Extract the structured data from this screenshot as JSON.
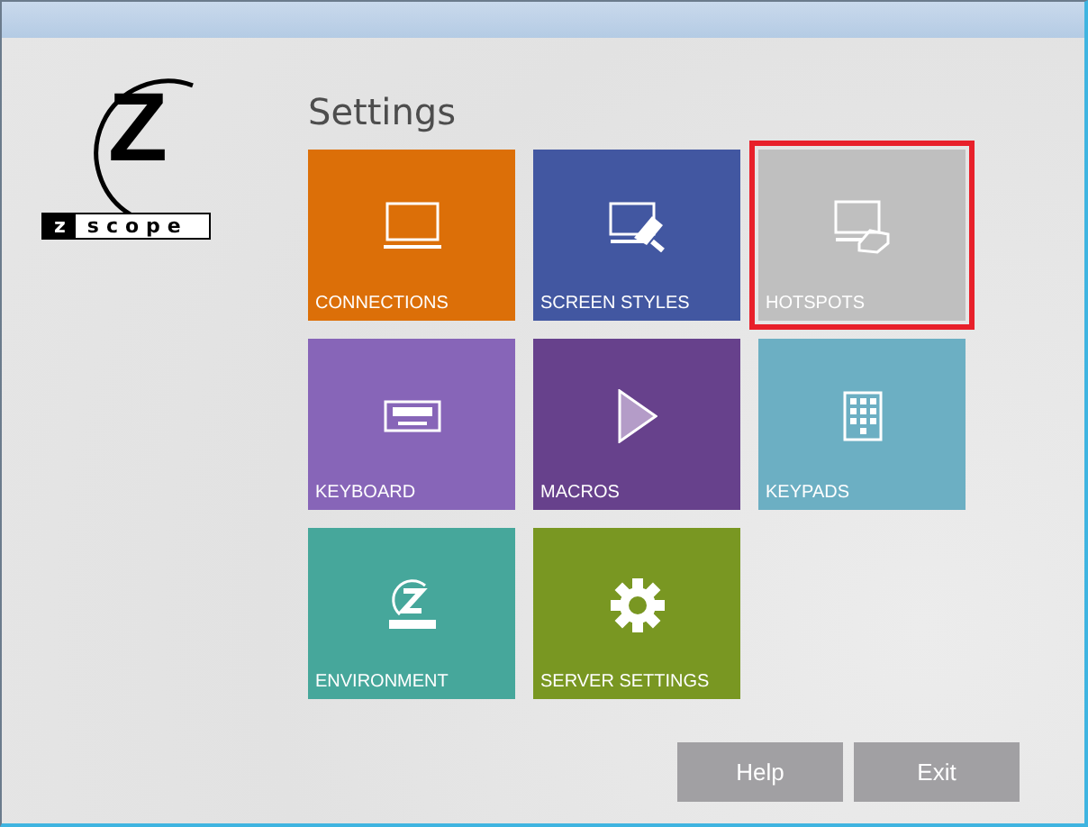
{
  "logo": {
    "letter": "Z",
    "badge_left": "z",
    "badge_right": "scope"
  },
  "title": "Settings",
  "tiles": [
    {
      "label": "CONNECTIONS",
      "kind": "monitor",
      "color": "#dc6f08",
      "selected": false
    },
    {
      "label": "SCREEN STYLES",
      "kind": "brush",
      "color": "#4257a1",
      "selected": false
    },
    {
      "label": "HOTSPOTS",
      "kind": "hotspot",
      "color": "#bfbfbf",
      "selected": true
    },
    {
      "label": "KEYBOARD",
      "kind": "keyboard",
      "color": "#8765b8",
      "selected": false
    },
    {
      "label": "MACROS",
      "kind": "play",
      "color": "#67418c",
      "selected": false
    },
    {
      "label": "KEYPADS",
      "kind": "keypad",
      "color": "#6cafc3",
      "selected": false
    },
    {
      "label": "ENVIRONMENT",
      "kind": "logo",
      "color": "#46a79b",
      "selected": false
    },
    {
      "label": "SERVER SETTINGS",
      "kind": "gear",
      "color": "#799722",
      "selected": false
    }
  ],
  "buttons": [
    "Help",
    "Exit"
  ]
}
